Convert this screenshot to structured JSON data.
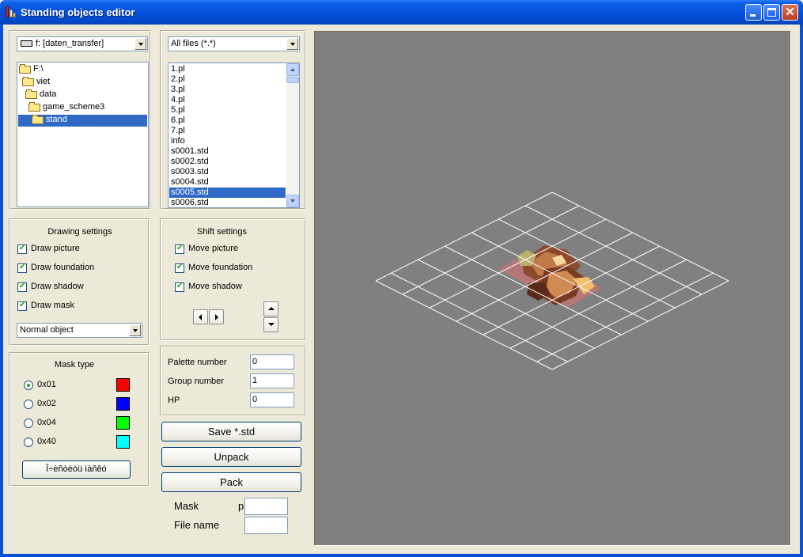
{
  "window": {
    "title": "Standing objects editor",
    "minimize_icon": "minimize-icon",
    "maximize_icon": "maximize-icon",
    "close_icon": "close-icon"
  },
  "drive_combo": {
    "value": "f: [daten_transfer]",
    "icon": "drive-icon"
  },
  "filter_combo": {
    "value": "All files (*.*)"
  },
  "folder_tree": {
    "items": [
      {
        "label": "F:\\",
        "selected": false
      },
      {
        "label": "viet",
        "selected": false
      },
      {
        "label": "data",
        "selected": false
      },
      {
        "label": "game_scheme3",
        "selected": false
      },
      {
        "label": "stand",
        "selected": true
      }
    ]
  },
  "file_list": {
    "items": [
      "1.pl",
      "2.pl",
      "3.pl",
      "4.pl",
      "5.pl",
      "6.pl",
      "7.pl",
      "info",
      "s0001.std",
      "s0002.std",
      "s0003.std",
      "s0004.std",
      "s0005.std",
      "s0006.std"
    ],
    "selected": "s0005.std"
  },
  "drawing_settings": {
    "title": "Drawing settings",
    "draw_picture": "Draw picture",
    "draw_foundation": "Draw foundation",
    "draw_shadow": "Draw shadow",
    "draw_mask": "Draw mask",
    "object_type": "Normal object"
  },
  "shift_settings": {
    "title": "Shift settings",
    "move_picture": "Move picture",
    "move_foundation": "Move foundation",
    "move_shadow": "Move shadow"
  },
  "mask_type": {
    "title": "Mask type",
    "options": [
      {
        "label": "0x01",
        "color": "#ff0000",
        "checked": true
      },
      {
        "label": "0x02",
        "color": "#0000ff",
        "checked": false
      },
      {
        "label": "0x04",
        "color": "#00ff00",
        "checked": false
      },
      {
        "label": "0x40",
        "color": "#00ffff",
        "checked": false
      }
    ],
    "clear_button": "Î÷èñòèòü ìàñêó"
  },
  "properties": {
    "palette_label": "Palette number",
    "palette_value": "0",
    "group_label": "Group number",
    "group_value": "1",
    "hp_label": "HP",
    "hp_value": "0"
  },
  "actions": {
    "save": "Save *.std",
    "unpack": "Unpack",
    "pack": "Pack"
  },
  "bottom_fields": {
    "mask_label": "Mask",
    "mask_prefix": "p",
    "mask_value": "",
    "file_name_label": "File name",
    "file_name_value": ""
  },
  "preview": {
    "background": "#808080",
    "grid_color": "#ffffff",
    "foundation_color": "#e07070",
    "object": "building-sprite"
  }
}
